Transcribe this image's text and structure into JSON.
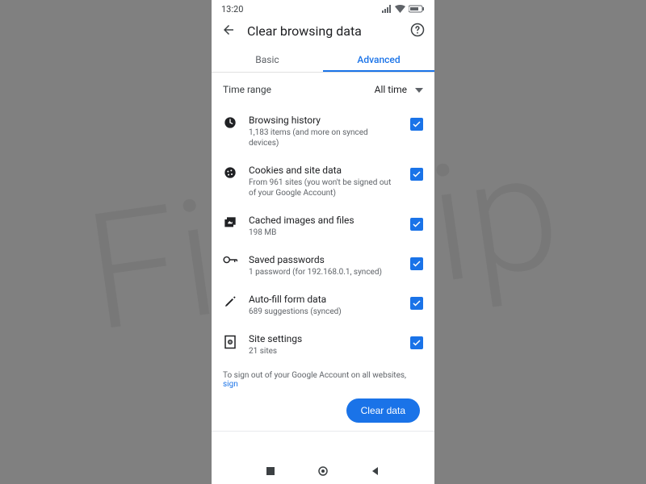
{
  "watermark": "Fixotip",
  "status": {
    "time": "13:20"
  },
  "header": {
    "title": "Clear browsing data"
  },
  "tabs": {
    "basic": "Basic",
    "advanced": "Advanced",
    "active": "advanced"
  },
  "time_range": {
    "label": "Time range",
    "value": "All time"
  },
  "options": [
    {
      "icon": "clock",
      "title": "Browsing history",
      "sub": "1,183 items (and more on synced devices)",
      "checked": true
    },
    {
      "icon": "cookie",
      "title": "Cookies and site data",
      "sub": "From 961 sites (you won't be signed out of your Google Account)",
      "checked": true
    },
    {
      "icon": "image",
      "title": "Cached images and files",
      "sub": "198 MB",
      "checked": true
    },
    {
      "icon": "key",
      "title": "Saved passwords",
      "sub": "1 password (for 192.168.0.1, synced)",
      "checked": true
    },
    {
      "icon": "pencil",
      "title": "Auto-fill form data",
      "sub": "689 suggestions (synced)",
      "checked": true
    },
    {
      "icon": "settings-page",
      "title": "Site settings",
      "sub": "21 sites",
      "checked": true
    }
  ],
  "footer": {
    "note": "To sign out of your Google Account on all websites, ",
    "link": "sign"
  },
  "action": {
    "clear": "Clear data"
  }
}
